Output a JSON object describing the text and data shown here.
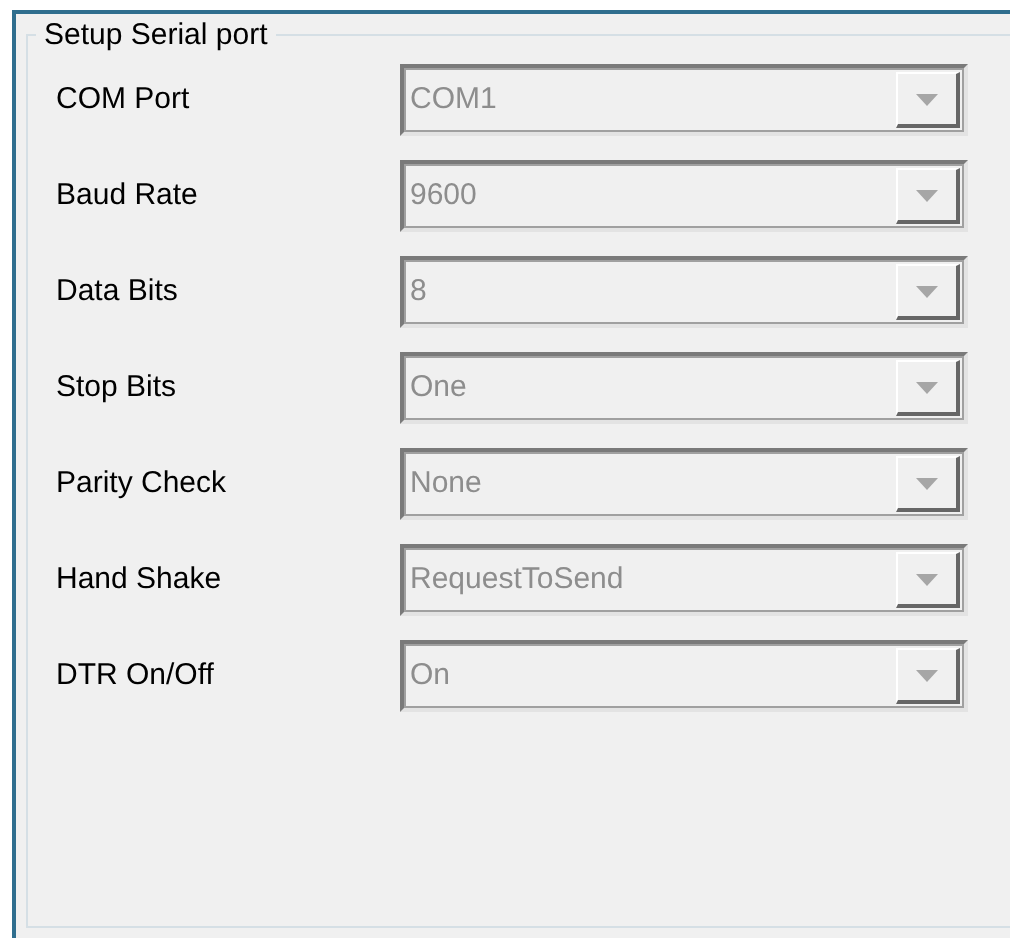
{
  "group": {
    "title": "Setup Serial port"
  },
  "fields": [
    {
      "label": "COM Port",
      "value": "COM1",
      "disabled": true
    },
    {
      "label": "Baud Rate",
      "value": "9600",
      "disabled": true
    },
    {
      "label": "Data Bits",
      "value": "8",
      "disabled": true
    },
    {
      "label": "Stop Bits",
      "value": "One",
      "disabled": true
    },
    {
      "label": "Parity Check",
      "value": "None",
      "disabled": true
    },
    {
      "label": "Hand Shake",
      "value": "RequestToSend",
      "disabled": true
    },
    {
      "label": "DTR On/Off",
      "value": "On",
      "disabled": true
    }
  ]
}
